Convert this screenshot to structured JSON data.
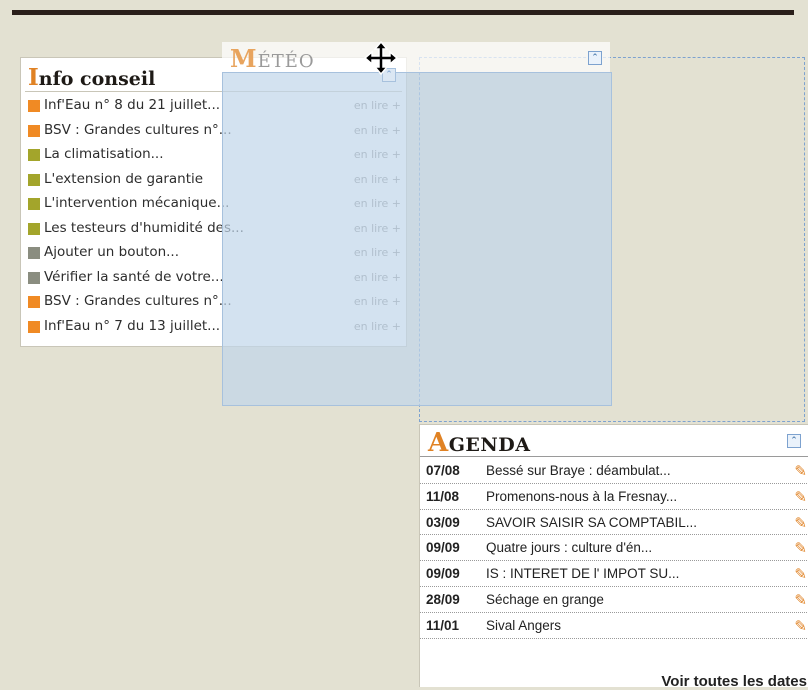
{
  "info_conseil": {
    "title_first": "I",
    "title_rest": "nfo conseil",
    "items": [
      {
        "label": "Inf'Eau n° 8 du 21 juillet...",
        "more": "en lire +",
        "color": "#f08a24"
      },
      {
        "label": "BSV : Grandes cultures n°...",
        "more": "en lire +",
        "color": "#f08a24"
      },
      {
        "label": "La climatisation...",
        "more": "en lire +",
        "color": "#a3a52b"
      },
      {
        "label": "L'extension de garantie",
        "more": "en lire +",
        "color": "#a3a52b"
      },
      {
        "label": "L'intervention mécanique...",
        "more": "en lire +",
        "color": "#a3a52b"
      },
      {
        "label": "Les testeurs d'humidité des...",
        "more": "en lire +",
        "color": "#a3a52b"
      },
      {
        "label": "Ajouter un bouton...",
        "more": "en lire +",
        "color": "#8a8d80"
      },
      {
        "label": "Vérifier la santé de votre...",
        "more": "en lire +",
        "color": "#8a8d80"
      },
      {
        "label": "BSV : Grandes cultures n°...",
        "more": "en lire +",
        "color": "#f08a24"
      },
      {
        "label": "Inf'Eau n° 7 du 13 juillet...",
        "more": "en lire +",
        "color": "#f08a24"
      }
    ]
  },
  "meteo": {
    "title_first": "M",
    "title_rest": "ÉTÉO",
    "collapse_icon": "double-chevron-up-icon",
    "state": "dragging"
  },
  "agenda": {
    "title_first": "A",
    "title_rest": "GENDA",
    "collapse_icon": "double-chevron-up-icon",
    "events": [
      {
        "date": "07/08",
        "label": "Bessé sur Braye : déambulat..."
      },
      {
        "date": "11/08",
        "label": "Promenons-nous à la Fresnay..."
      },
      {
        "date": "03/09",
        "label": " SAVOIR SAISIR SA COMPTABIL..."
      },
      {
        "date": "09/09",
        "label": "Quatre jours : culture d'én..."
      },
      {
        "date": "09/09",
        "label": "IS : INTERET DE l' IMPOT SU..."
      },
      {
        "date": "28/09",
        "label": "Séchage en grange"
      },
      {
        "date": "11/01",
        "label": "Sival Angers"
      }
    ],
    "see_all": "Voir toutes les dates"
  },
  "colors": {
    "accent": "#e08224",
    "page_bg": "#e3e1d2",
    "drag_ghost": "#c0d6ea",
    "drop_border": "#7da2cf"
  }
}
